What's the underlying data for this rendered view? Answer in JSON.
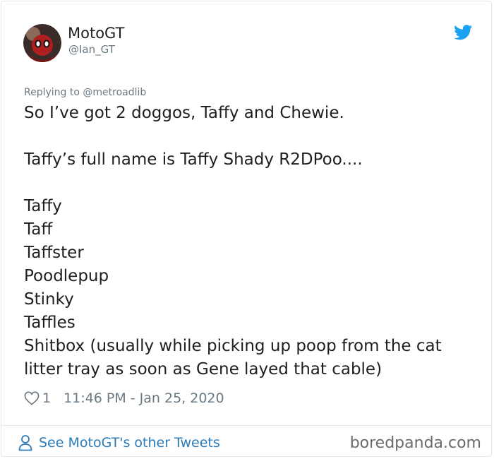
{
  "tweet": {
    "author": {
      "display_name": "MotoGT",
      "handle": "@Ian_GT"
    },
    "icons": {
      "avatar": "avatar-photo",
      "platform": "twitter-bird-icon",
      "like": "heart-icon",
      "profile": "person-icon"
    },
    "replying_to": {
      "prefix": "Replying to ",
      "mention": "@metroadlib"
    },
    "text_lines": [
      "So I’ve got 2 doggos, Taffy and Chewie.",
      "Taffy’s full name is Taffy Shady R2DPoo....",
      "Taffy",
      "Taff",
      "Taffster",
      "Poodlepup",
      "Stinky",
      "Taffles",
      "Shitbox (usually while picking up poop from the cat litter tray as soon as Gene layed that cable)"
    ],
    "likes": "1",
    "timestamp": "11:46 PM - Jan 25, 2020",
    "see_more": "See MotoGT's other Tweets"
  },
  "watermark": "boredpanda.com",
  "colors": {
    "text": "#1c2022",
    "secondary": "#697882",
    "link": "#2b7bb9",
    "twitter_blue": "#1da1f2",
    "border": "#e1e8ed"
  }
}
